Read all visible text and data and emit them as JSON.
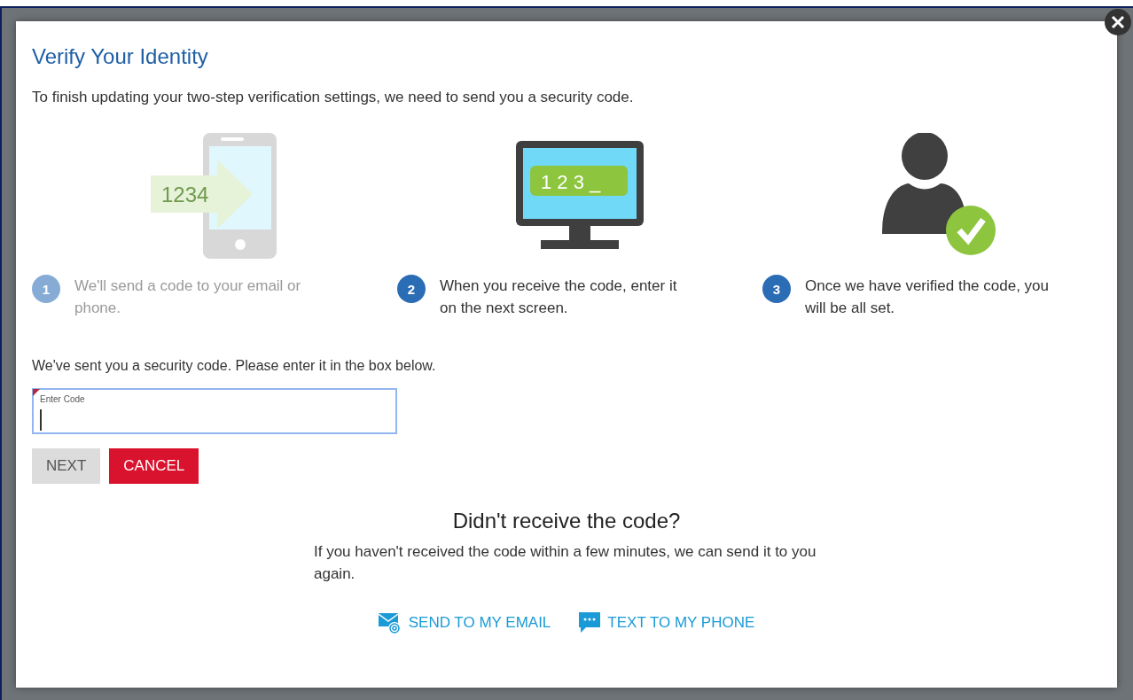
{
  "dialog": {
    "title": "Verify Your Identity",
    "intro": "To finish updating your two-step verification settings, we need to send you a security code.",
    "steps": [
      {
        "number": "1",
        "text": "We'll send a code to your email or phone.",
        "kind": "phone",
        "active": false,
        "code": "1234"
      },
      {
        "number": "2",
        "text": "When you receive the code, enter it on the next screen.",
        "kind": "monitor",
        "active": true,
        "code": "1 2 3 _"
      },
      {
        "number": "3",
        "text": "Once we have verified the code, you will be all set.",
        "kind": "user",
        "active": true
      }
    ],
    "sent_message": "We've sent you a security code. Please enter it in the box below.",
    "code_field": {
      "label": "Enter Code",
      "required": true,
      "focused": true
    },
    "buttons": [
      {
        "label": "NEXT",
        "kind": "secondary",
        "disabled": true
      },
      {
        "label": "CANCEL",
        "kind": "danger",
        "disabled": false
      }
    ],
    "resend": {
      "heading": "Didn't receive the code?",
      "text": "If you haven't received the code within a few minutes, we can send it to you again.",
      "links": [
        {
          "label": "SEND TO MY EMAIL",
          "kind": "email"
        },
        {
          "label": "TEXT TO MY PHONE",
          "kind": "sms"
        }
      ]
    }
  }
}
